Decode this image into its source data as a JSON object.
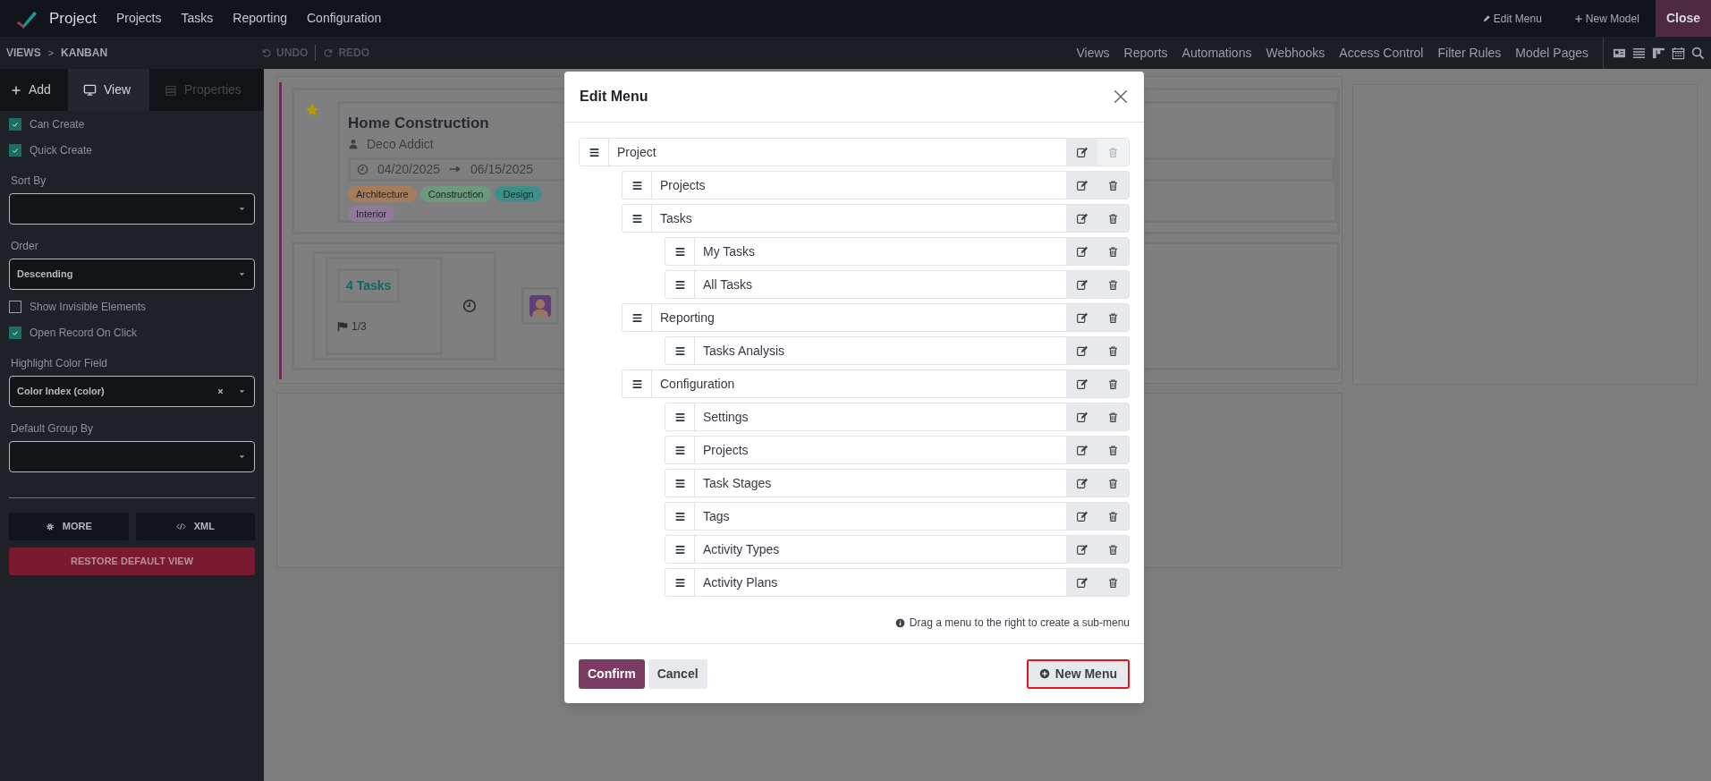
{
  "app": {
    "title": "Project",
    "menu": [
      "Projects",
      "Tasks",
      "Reporting",
      "Configuration"
    ],
    "actions": [
      {
        "kind": "edit",
        "label": "Edit Menu"
      },
      {
        "kind": "new",
        "label": "New Model"
      }
    ],
    "close": "Close"
  },
  "subbar": {
    "breadcrumb": [
      "VIEWS",
      "KANBAN"
    ],
    "separator": ">",
    "history": [
      {
        "kind": "undo",
        "label": "UNDO",
        "disabled": true
      },
      {
        "kind": "redo",
        "label": "REDO",
        "disabled": true
      }
    ],
    "links": [
      "Views",
      "Reports",
      "Automations",
      "Webhooks",
      "Access Control",
      "Filter Rules",
      "Model Pages"
    ]
  },
  "sidebar": {
    "tabs": [
      {
        "kind": "add",
        "label": "Add",
        "selected": false
      },
      {
        "kind": "view",
        "label": "View",
        "selected": true
      },
      {
        "kind": "properties",
        "label": "Properties",
        "selected": false
      }
    ],
    "options": [
      {
        "kind": "checkbox",
        "label": "Can Create",
        "checked": true
      },
      {
        "kind": "checkbox",
        "label": "Quick Create",
        "checked": true
      },
      {
        "kind": "select",
        "label": "Sort By",
        "clearable": false
      },
      {
        "kind": "select",
        "label": "Order",
        "value": "Descending",
        "clearable": false
      },
      {
        "kind": "checkbox",
        "label": "Show Invisible Elements",
        "checked": false
      },
      {
        "kind": "checkbox",
        "label": "Open Record On Click",
        "checked": true
      },
      {
        "kind": "select",
        "label": "Highlight Color Field",
        "value": "Color Index (color)",
        "clearable": true
      },
      {
        "kind": "select",
        "label": "Default Group By",
        "clearable": false
      }
    ],
    "buttons": [
      {
        "kind": "more",
        "label": "MORE"
      },
      {
        "kind": "xml",
        "label": "XML"
      }
    ],
    "restore": "RESTORE DEFAULT VIEW"
  },
  "kanban": {
    "card": {
      "title": "Home Construction",
      "customer": "Deco Addict",
      "start": "04/20/2025",
      "end": "06/15/2025",
      "tags": [
        {
          "label": "Architecture",
          "color": "#a57d5b"
        },
        {
          "label": "Construction",
          "color": "#6d9a7c"
        },
        {
          "label": "Design",
          "color": "#3e8f8a"
        },
        {
          "label": "Interior",
          "color": "#8f7b99"
        }
      ],
      "favorite": true,
      "tasks": "4 Tasks",
      "milestones": "1/3"
    }
  },
  "dialog": {
    "title": "Edit Menu",
    "menu_tree": [
      {
        "label": "Project",
        "deletable": false,
        "children": [
          {
            "label": "Projects",
            "deletable": true
          },
          {
            "label": "Tasks",
            "deletable": true,
            "children": [
              {
                "label": "My Tasks",
                "deletable": true
              },
              {
                "label": "All Tasks",
                "deletable": true
              }
            ]
          },
          {
            "label": "Reporting",
            "deletable": true,
            "children": [
              {
                "label": "Tasks Analysis",
                "deletable": true
              }
            ]
          },
          {
            "label": "Configuration",
            "deletable": true,
            "children": [
              {
                "label": "Settings",
                "deletable": true
              },
              {
                "label": "Projects",
                "deletable": true
              },
              {
                "label": "Task Stages",
                "deletable": true
              },
              {
                "label": "Tags",
                "deletable": true
              },
              {
                "label": "Activity Types",
                "deletable": true
              },
              {
                "label": "Activity Plans",
                "deletable": true
              }
            ]
          }
        ]
      }
    ],
    "hint": "Drag a menu to the right to create a sub-menu",
    "buttons": [
      {
        "kind": "primary",
        "label": "Confirm"
      },
      {
        "kind": "secondary",
        "label": "Cancel"
      }
    ],
    "new_menu": {
      "label": "New Menu",
      "highlighted": true
    }
  }
}
